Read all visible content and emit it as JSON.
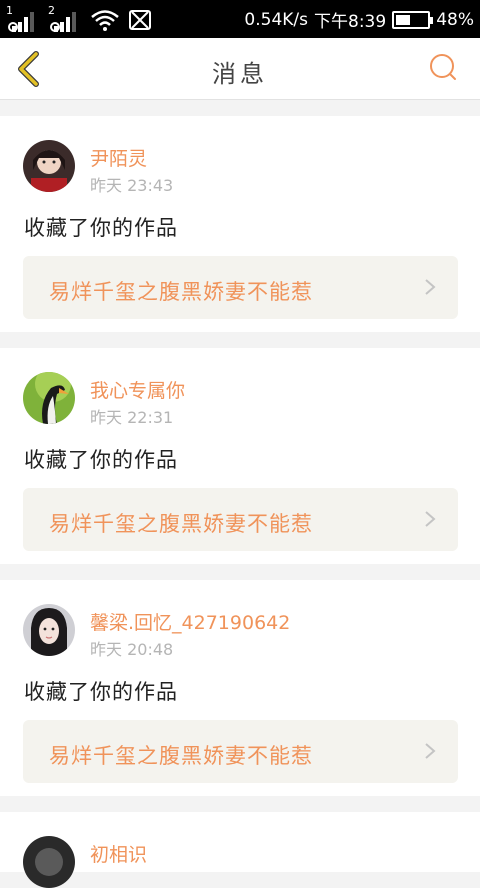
{
  "status_bar": {
    "sim1": "1",
    "sim2": "2",
    "net_speed": "0.54K/s",
    "time": "下午8:39",
    "battery": "48%",
    "battery_level": 0.48
  },
  "header": {
    "title": "消息"
  },
  "messages": [
    {
      "username": "尹陌灵",
      "time": "昨天 23:43",
      "action": "收藏了你的作品",
      "work_title": "易烊千玺之腹黑娇妻不能惹"
    },
    {
      "username": "我心专属你",
      "time": "昨天 22:31",
      "action": "收藏了你的作品",
      "work_title": "易烊千玺之腹黑娇妻不能惹"
    },
    {
      "username": "馨梁.回忆_427190642",
      "time": "昨天 20:48",
      "action": "收藏了你的作品",
      "work_title": "易烊千玺之腹黑娇妻不能惹"
    },
    {
      "username": "初相识"
    }
  ],
  "colors": {
    "accent": "#f0935a",
    "back_arrow": "#e3c126"
  }
}
